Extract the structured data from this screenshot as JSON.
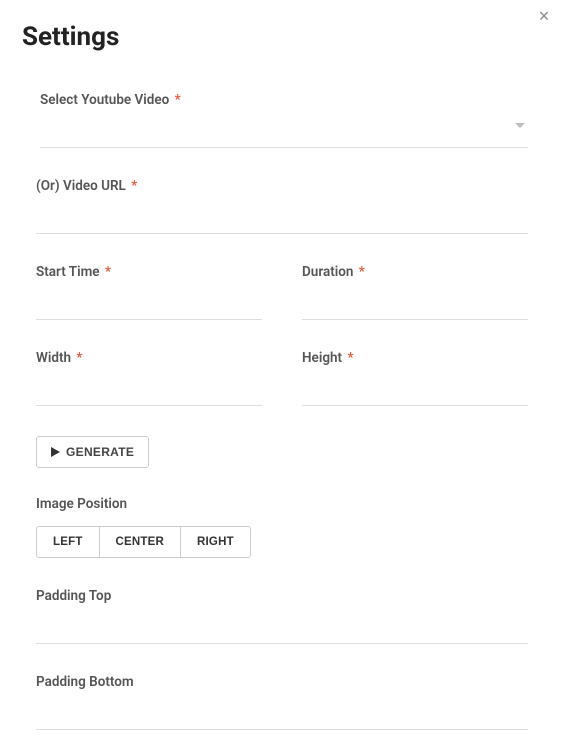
{
  "title": "Settings",
  "close_label": "×",
  "select_video": {
    "label": "Select Youtube Video",
    "required": "*",
    "value": ""
  },
  "video_url": {
    "label": "(Or) Video URL",
    "required": "*",
    "value": ""
  },
  "start_time": {
    "label": "Start Time",
    "required": "*",
    "value": ""
  },
  "duration": {
    "label": "Duration",
    "required": "*",
    "value": ""
  },
  "width": {
    "label": "Width",
    "required": "*",
    "value": ""
  },
  "height": {
    "label": "Height",
    "required": "*",
    "value": ""
  },
  "generate_label": "GENERATE",
  "image_position": {
    "label": "Image Position",
    "left": "LEFT",
    "center": "CENTER",
    "right": "RIGHT"
  },
  "padding_top": {
    "label": "Padding Top",
    "value": ""
  },
  "padding_bottom": {
    "label": "Padding Bottom",
    "value": ""
  }
}
